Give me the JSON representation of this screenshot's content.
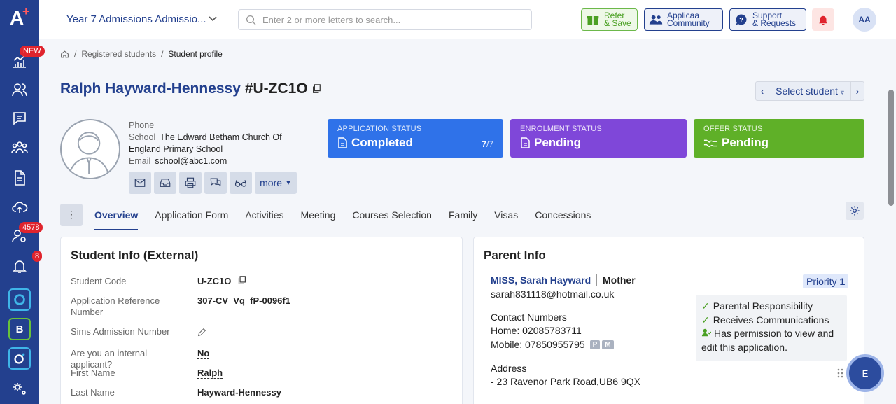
{
  "sidebar": {
    "new_badge": "NEW",
    "students_badge": "4578",
    "notifications_badge": "8",
    "apps": [
      "B"
    ]
  },
  "topbar": {
    "year_select": "Year 7 Admissions Admissio...",
    "search_placeholder": "Enter 2 or more letters to search...",
    "refer_line1": "Refer",
    "refer_line2": "& Save",
    "community_line1": "Applicaa",
    "community_line2": "Community",
    "support_line1": "Support",
    "support_line2": "& Requests",
    "avatar": "AA"
  },
  "breadcrumb": {
    "sep": "/",
    "items": [
      "Registered students",
      "Student profile"
    ]
  },
  "student": {
    "name": "Ralph Hayward-Hennessy",
    "code": "#U-ZC1O",
    "phone_label": "Phone",
    "school_label": "School",
    "school_value": "The Edward Betham Church Of England Primary School",
    "email_label": "Email",
    "email_value": "school@abc1.com",
    "more_label": "more"
  },
  "select_student": "Select student",
  "status_cards": {
    "application": {
      "label": "APPLICATION STATUS",
      "value": "Completed",
      "count": "7",
      "total": "/7"
    },
    "enrolment": {
      "label": "ENROLMENT STATUS",
      "value": "Pending"
    },
    "offer": {
      "label": "OFFER STATUS",
      "value": "Pending"
    }
  },
  "tabs": [
    "Overview",
    "Application Form",
    "Activities",
    "Meeting",
    "Courses Selection",
    "Family",
    "Visas",
    "Concessions"
  ],
  "student_info": {
    "title": "Student Info (External)",
    "rows": [
      {
        "label": "Student Code",
        "value": "U-ZC1O"
      },
      {
        "label": "Application Reference Number",
        "value": "307-CV_Vq_fP-0096f1"
      },
      {
        "label": "Sims Admission Number",
        "value": ""
      },
      {
        "label": "Are you an internal applicant?",
        "value": "No"
      },
      {
        "label": "First Name",
        "value": "Ralph"
      },
      {
        "label": "Last Name",
        "value": "Hayward-Hennessy"
      }
    ]
  },
  "parent_info": {
    "title": "Parent Info",
    "name": "MISS, Sarah Hayward",
    "relation": "Mother",
    "email": "sarah831118@hotmail.co.uk",
    "priority_label": "Priority",
    "priority_value": "1",
    "contact_heading": "Contact Numbers",
    "home": "Home: 02085783711",
    "mobile": "Mobile: 07850955795",
    "mobile_tags": [
      "P",
      "M"
    ],
    "address_heading": "Address",
    "address": "- 23 Ravenor Park Road,UB6 9QX",
    "permissions": [
      "Parental Responsibility",
      "Receives Communications",
      "Has permission to view and edit this application."
    ]
  },
  "fab_label": "E"
}
